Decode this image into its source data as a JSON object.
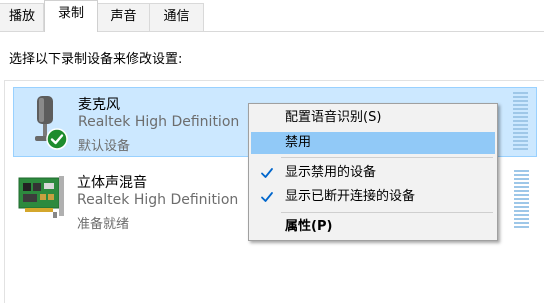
{
  "tabs": [
    {
      "label": "播放"
    },
    {
      "label": "录制"
    },
    {
      "label": "声音"
    },
    {
      "label": "通信"
    }
  ],
  "instruction": "选择以下录制设备来修改设置:",
  "devices": [
    {
      "name": "麦克风",
      "description": "Realtek High Definition",
      "status": "默认设备",
      "icon": "microphone-icon",
      "badge": "default-check-icon"
    },
    {
      "name": "立体声混音",
      "description": "Realtek High Definition",
      "status": "准备就绪",
      "icon": "sound-card-icon"
    }
  ],
  "context_menu": {
    "items": [
      {
        "label": "配置语音识别(S)"
      },
      {
        "label": "禁用"
      },
      {
        "label": "显示禁用的设备"
      },
      {
        "label": "显示已断开连接的设备"
      },
      {
        "label": "属性(P)"
      }
    ]
  },
  "colors": {
    "selection_bg": "#cce8ff",
    "selection_border": "#99d1ff",
    "menu_highlight": "#91c9f7",
    "check_color": "#0066cc",
    "badge_green": "#1e8c2e"
  }
}
